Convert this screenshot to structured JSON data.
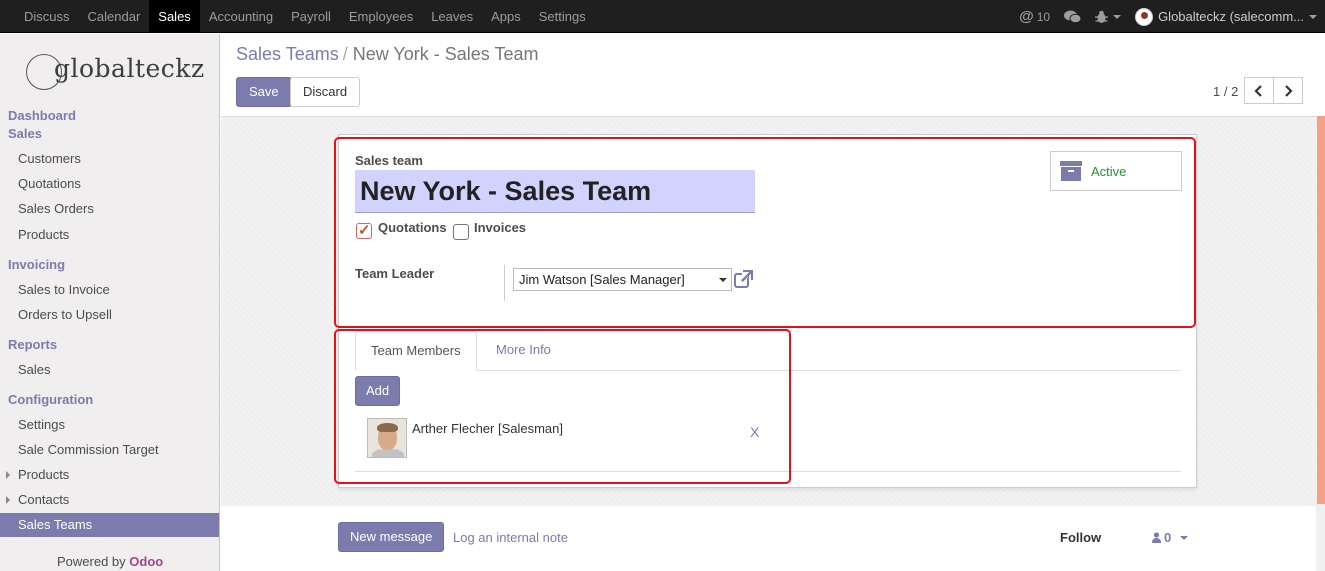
{
  "topbar": {
    "menu": [
      "Discuss",
      "Calendar",
      "Sales",
      "Accounting",
      "Payroll",
      "Employees",
      "Leaves",
      "Apps",
      "Settings"
    ],
    "active_menu": "Sales",
    "mentions_count": "10",
    "user_label": "Globalteckz (salecomm..."
  },
  "sidebar": {
    "logo_text": "globalteckz",
    "sections": {
      "dashboard": "Dashboard",
      "sales": "Sales",
      "invoicing": "Invoicing",
      "reports": "Reports",
      "configuration": "Configuration"
    },
    "sales_items": [
      "Customers",
      "Quotations",
      "Sales Orders",
      "Products"
    ],
    "invoicing_items": [
      "Sales to Invoice",
      "Orders to Upsell"
    ],
    "reports_items": [
      "Sales"
    ],
    "configuration_items": [
      "Settings",
      "Sale Commission Target",
      "Products",
      "Contacts",
      "Sales Teams"
    ],
    "active_item": "Sales Teams",
    "powered_by": "Powered by",
    "powered_brand": "Odoo"
  },
  "breadcrumb": {
    "parent": "Sales Teams",
    "separator": "/",
    "current": "New York - Sales Team"
  },
  "toolbar": {
    "save_label": "Save",
    "discard_label": "Discard"
  },
  "pager": {
    "value": "1 / 2"
  },
  "form": {
    "name_label": "Sales team",
    "name_value": "New York - Sales Team",
    "quotations_label": "Quotations",
    "quotations_checked": true,
    "invoices_label": "Invoices",
    "invoices_checked": false,
    "active_label": "Active",
    "team_leader_label": "Team Leader",
    "team_leader_value": "Jim Watson [Sales Manager]"
  },
  "tabs": {
    "team_members": "Team Members",
    "more_info": "More Info",
    "add_label": "Add",
    "members": [
      {
        "name": "Arther Flecher [Salesman]",
        "remove": "X"
      }
    ]
  },
  "chatter": {
    "new_message": "New message",
    "log_note": "Log an internal note",
    "follow": "Follow",
    "followers_count": "0"
  },
  "colors": {
    "accent": "#7c7bad",
    "topbar": "#1f1f1f",
    "highlight": "#e2121d",
    "active_status": "#2e8b2e"
  }
}
